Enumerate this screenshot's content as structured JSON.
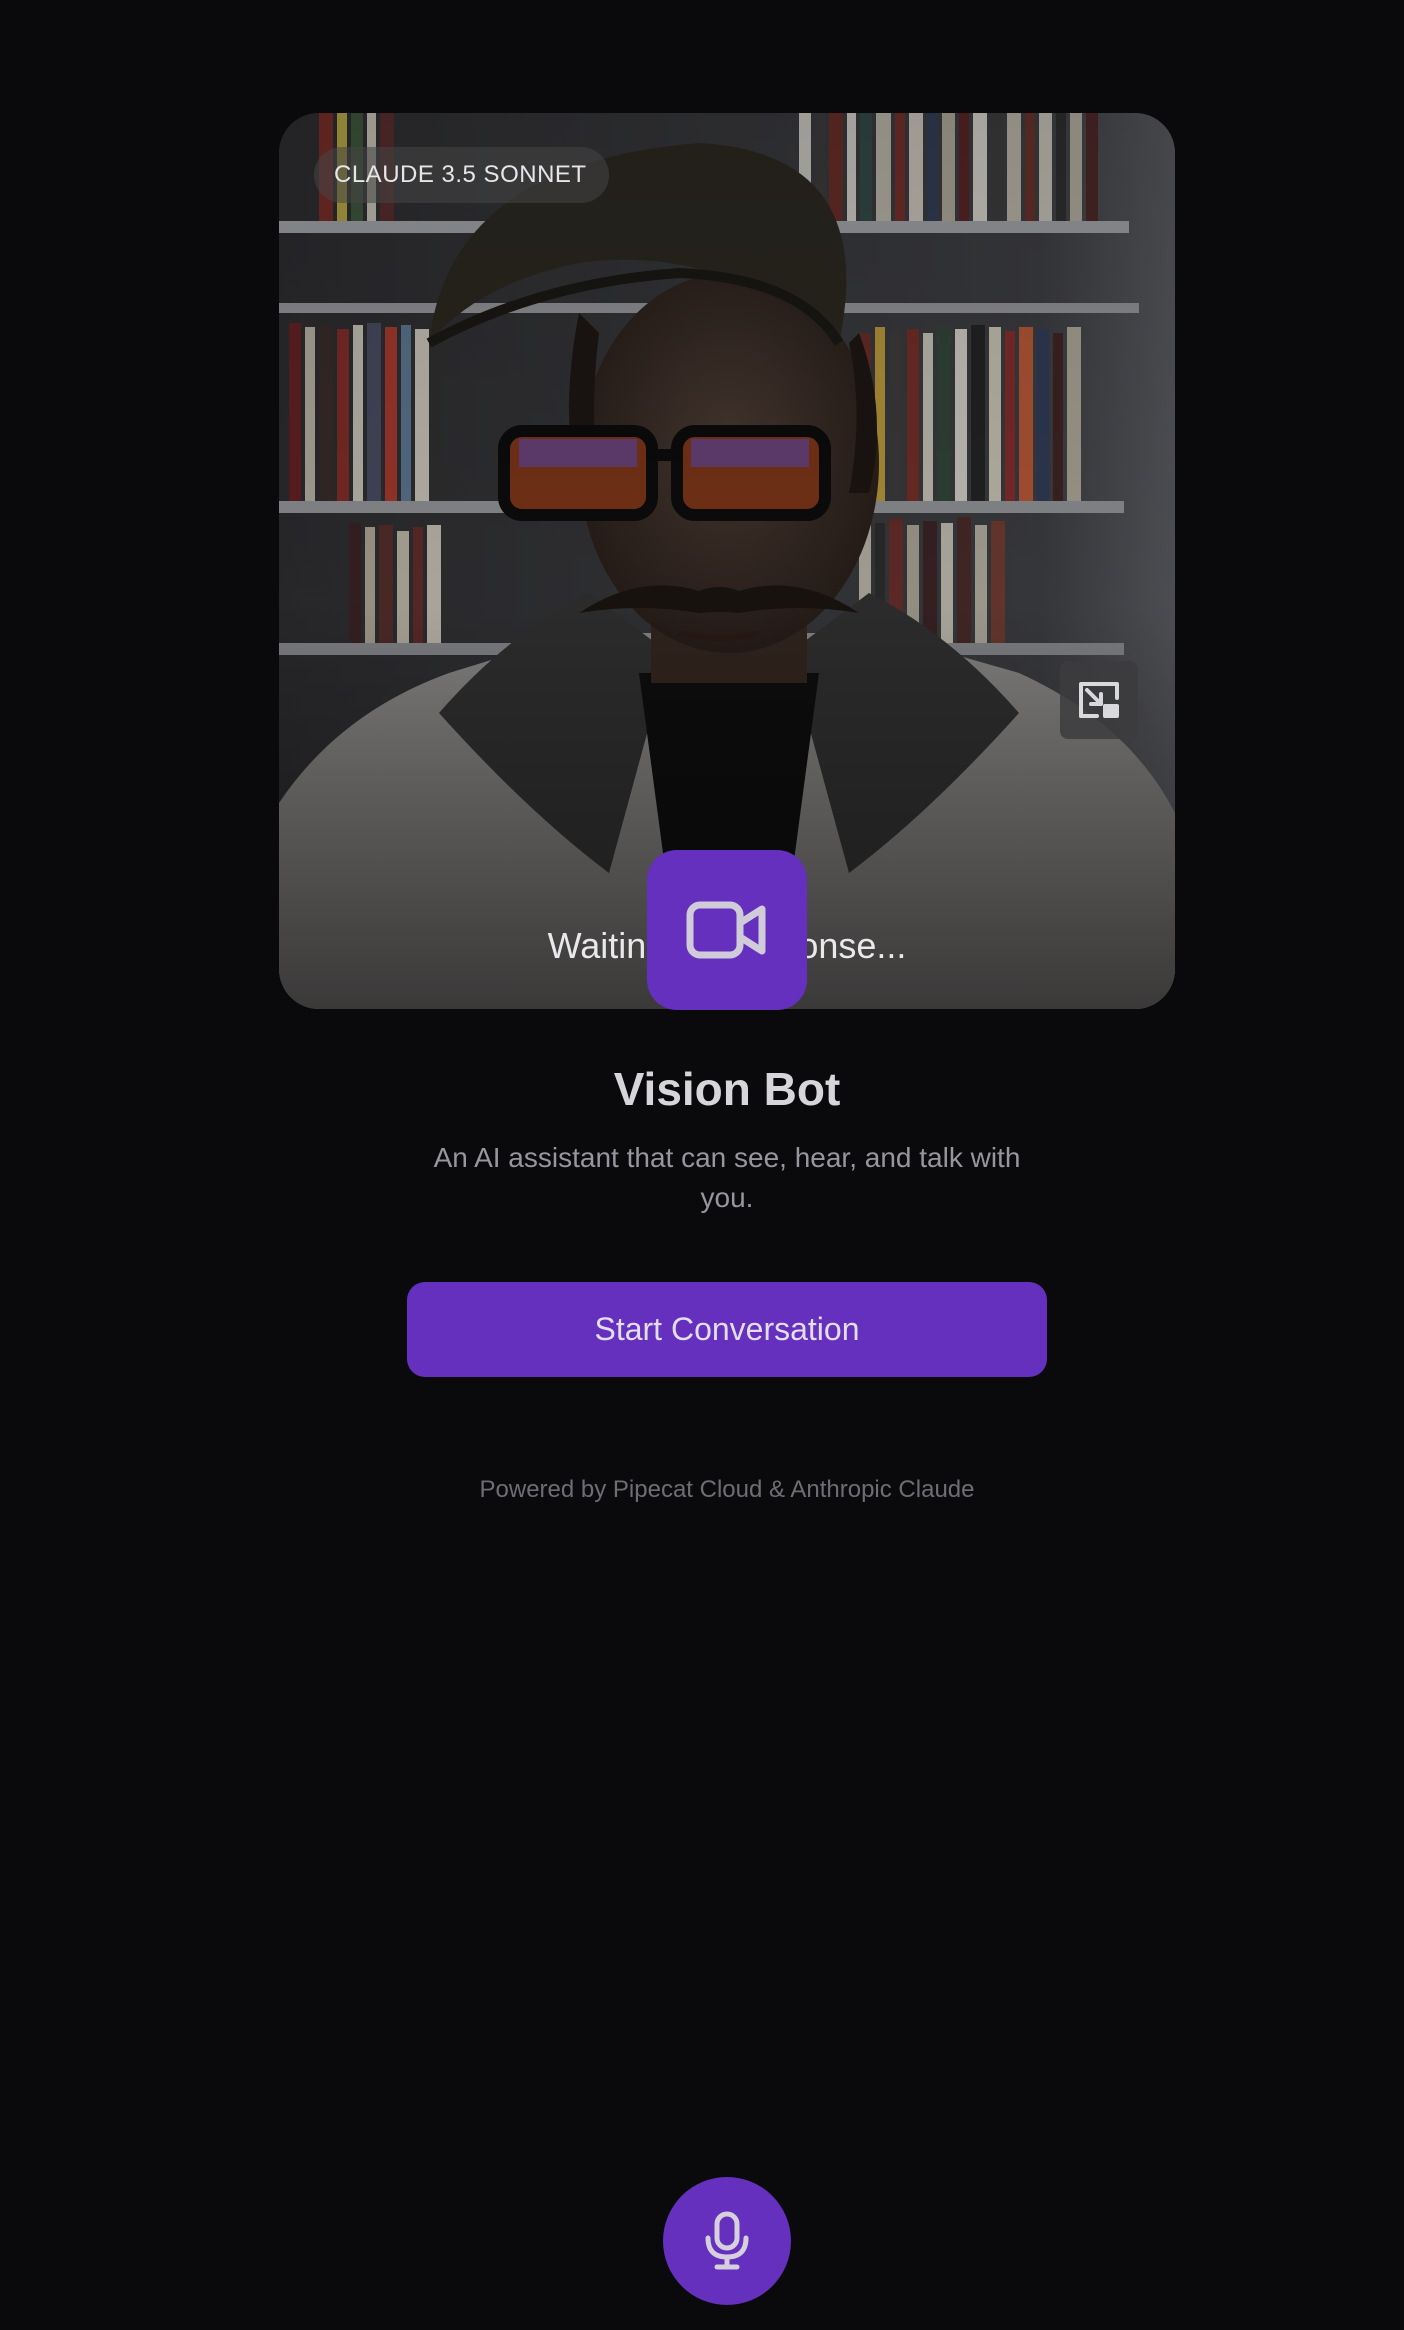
{
  "video": {
    "model_badge": "CLAUDE 3.5 SONNET",
    "status_text": "Waiting for response...",
    "pip_icon": "picture-in-picture-icon",
    "camera_icon": "video-camera-icon"
  },
  "hero": {
    "title": "Vision Bot",
    "subtitle": "An AI assistant that can see, hear, and talk with you."
  },
  "actions": {
    "start_label": "Start Conversation"
  },
  "footer": {
    "text": "Powered by Pipecat Cloud & Anthropic Claude"
  },
  "controls": {
    "mic_icon": "microphone-icon"
  },
  "colors": {
    "background": "#0a0a0d",
    "accent": "#6530bd",
    "title": "#d6d6da",
    "muted": "#96969d",
    "footer": "#6d6d74"
  }
}
